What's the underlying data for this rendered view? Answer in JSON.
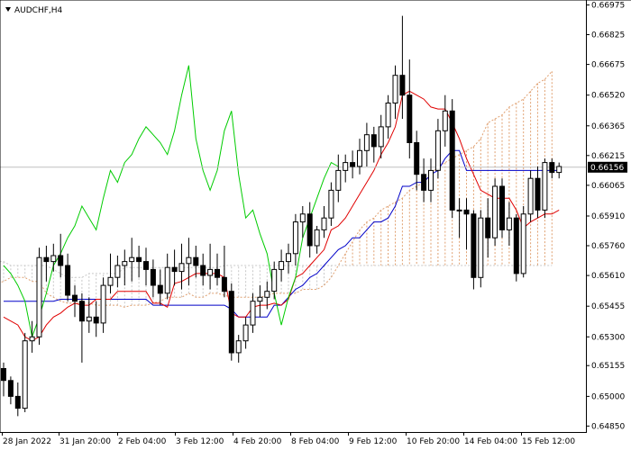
{
  "window": {
    "symbol_title": "AUDCHF,H4"
  },
  "colors": {
    "background": "#ffffff",
    "axis": "#000000",
    "bull_candle_body": "#ffffff",
    "bear_candle_body": "#000000",
    "tenkan_sen": "#e00000",
    "kijun_sen": "#0000c8",
    "chikou_span": "#00cc00",
    "senkou_span_a": "#e0a070",
    "senkou_span_b": "#c8c8c8",
    "current_price_line": "#c0c0c0",
    "price_tag_bg": "#000000",
    "price_tag_text": "#ffffff"
  },
  "chart_data": {
    "type": "candlestick",
    "title": "AUDCHF,H4",
    "x_tick_labels": [
      "28 Jan 2022",
      "31 Jan 20:00",
      "2 Feb 04:00",
      "3 Feb 12:00",
      "4 Feb 20:00",
      "8 Feb 04:00",
      "9 Feb 12:00",
      "10 Feb 20:00",
      "14 Feb 04:00",
      "15 Feb 12:00"
    ],
    "y_tick_labels": [
      "0.66975",
      "0.66825",
      "0.66675",
      "0.66520",
      "0.66365",
      "0.66215",
      "0.66065",
      "0.65910",
      "0.65760",
      "0.65610",
      "0.65455",
      "0.65300",
      "0.65155",
      "0.65000",
      "0.64850"
    ],
    "ylim": [
      0.6482,
      0.67
    ],
    "current_price": 0.66156,
    "current_price_label": "0.66156",
    "grid": false,
    "candles": [
      [
        0.6514,
        0.6517,
        0.65,
        0.6508
      ],
      [
        0.6508,
        0.651,
        0.6496,
        0.65
      ],
      [
        0.65,
        0.6507,
        0.649,
        0.6494
      ],
      [
        0.6494,
        0.6532,
        0.6492,
        0.6528
      ],
      [
        0.6528,
        0.6538,
        0.6522,
        0.653
      ],
      [
        0.653,
        0.6575,
        0.6526,
        0.657
      ],
      [
        0.657,
        0.6576,
        0.6558,
        0.6568
      ],
      [
        0.6568,
        0.6577,
        0.6563,
        0.6571
      ],
      [
        0.6571,
        0.6582,
        0.656,
        0.6566
      ],
      [
        0.6566,
        0.6572,
        0.6548,
        0.6551
      ],
      [
        0.6551,
        0.6556,
        0.654,
        0.6548
      ],
      [
        0.6548,
        0.6552,
        0.6517,
        0.6538
      ],
      [
        0.6538,
        0.655,
        0.6532,
        0.654
      ],
      [
        0.654,
        0.6548,
        0.653,
        0.6537
      ],
      [
        0.6537,
        0.656,
        0.6532,
        0.6556
      ],
      [
        0.6556,
        0.6572,
        0.6552,
        0.656
      ],
      [
        0.656,
        0.6571,
        0.6555,
        0.6566
      ],
      [
        0.6566,
        0.6574,
        0.6556,
        0.6568
      ],
      [
        0.6568,
        0.658,
        0.6558,
        0.657
      ],
      [
        0.657,
        0.6576,
        0.656,
        0.6568
      ],
      [
        0.6568,
        0.6575,
        0.6556,
        0.6564
      ],
      [
        0.6564,
        0.6569,
        0.655,
        0.6556
      ],
      [
        0.6556,
        0.6564,
        0.6546,
        0.6552
      ],
      [
        0.6552,
        0.6572,
        0.6549,
        0.6565
      ],
      [
        0.6565,
        0.6574,
        0.6556,
        0.6563
      ],
      [
        0.6563,
        0.6577,
        0.6554,
        0.6567
      ],
      [
        0.6567,
        0.658,
        0.6556,
        0.657
      ],
      [
        0.657,
        0.6576,
        0.656,
        0.6566
      ],
      [
        0.6566,
        0.6572,
        0.6556,
        0.6561
      ],
      [
        0.6561,
        0.6577,
        0.6554,
        0.6564
      ],
      [
        0.6564,
        0.6572,
        0.6556,
        0.656
      ],
      [
        0.656,
        0.6576,
        0.655,
        0.6553
      ],
      [
        0.6553,
        0.6557,
        0.6518,
        0.6522
      ],
      [
        0.6522,
        0.6531,
        0.6517,
        0.6528
      ],
      [
        0.6528,
        0.654,
        0.6524,
        0.6536
      ],
      [
        0.6536,
        0.6552,
        0.6532,
        0.6548
      ],
      [
        0.6548,
        0.6556,
        0.654,
        0.655
      ],
      [
        0.655,
        0.6558,
        0.6544,
        0.6553
      ],
      [
        0.6553,
        0.6568,
        0.6549,
        0.6564
      ],
      [
        0.6564,
        0.6574,
        0.6558,
        0.6568
      ],
      [
        0.6568,
        0.6577,
        0.6562,
        0.6572
      ],
      [
        0.6572,
        0.6592,
        0.6566,
        0.6588
      ],
      [
        0.6588,
        0.6596,
        0.658,
        0.6592
      ],
      [
        0.6592,
        0.6598,
        0.657,
        0.6576
      ],
      [
        0.6576,
        0.6586,
        0.6572,
        0.6584
      ],
      [
        0.6584,
        0.6596,
        0.658,
        0.659
      ],
      [
        0.659,
        0.6608,
        0.6586,
        0.6604
      ],
      [
        0.6604,
        0.6622,
        0.6598,
        0.6614
      ],
      [
        0.6614,
        0.6622,
        0.6608,
        0.6618
      ],
      [
        0.6618,
        0.6624,
        0.661,
        0.6616
      ],
      [
        0.6616,
        0.663,
        0.6612,
        0.6624
      ],
      [
        0.6624,
        0.6638,
        0.6616,
        0.6632
      ],
      [
        0.6632,
        0.6636,
        0.6618,
        0.6626
      ],
      [
        0.6626,
        0.6642,
        0.662,
        0.6636
      ],
      [
        0.6636,
        0.6652,
        0.663,
        0.6648
      ],
      [
        0.6648,
        0.6667,
        0.664,
        0.6662
      ],
      [
        0.6662,
        0.6692,
        0.664,
        0.6652
      ],
      [
        0.6652,
        0.667,
        0.662,
        0.6628
      ],
      [
        0.6628,
        0.6634,
        0.6604,
        0.6612
      ],
      [
        0.6612,
        0.662,
        0.6598,
        0.6604
      ],
      [
        0.6604,
        0.662,
        0.6598,
        0.6614
      ],
      [
        0.6614,
        0.664,
        0.661,
        0.6634
      ],
      [
        0.6634,
        0.6652,
        0.6626,
        0.6644
      ],
      [
        0.6644,
        0.665,
        0.659,
        0.6594
      ],
      [
        0.6594,
        0.66,
        0.658,
        0.6594
      ],
      [
        0.6594,
        0.66,
        0.6574,
        0.6592
      ],
      [
        0.6592,
        0.6594,
        0.6554,
        0.656
      ],
      [
        0.656,
        0.6594,
        0.6555,
        0.659
      ],
      [
        0.659,
        0.66,
        0.657,
        0.658
      ],
      [
        0.658,
        0.661,
        0.6576,
        0.6606
      ],
      [
        0.6606,
        0.661,
        0.658,
        0.6584
      ],
      [
        0.6584,
        0.6598,
        0.6576,
        0.659
      ],
      [
        0.659,
        0.6592,
        0.6558,
        0.6562
      ],
      [
        0.6562,
        0.6596,
        0.656,
        0.6592
      ],
      [
        0.6592,
        0.6614,
        0.6588,
        0.661
      ],
      [
        0.661,
        0.6616,
        0.659,
        0.6594
      ],
      [
        0.6594,
        0.662,
        0.659,
        0.6618
      ],
      [
        0.6618,
        0.662,
        0.661,
        0.6613
      ],
      [
        0.6613,
        0.6618,
        0.661,
        0.6616
      ]
    ],
    "tenkan_sen": [
      0.654,
      0.6538,
      0.6536,
      0.653,
      0.6528,
      0.653,
      0.6536,
      0.654,
      0.6542,
      0.6545,
      0.6547,
      0.6546,
      0.6546,
      0.6549,
      0.6549,
      0.6549,
      0.6553,
      0.6553,
      0.6553,
      0.6553,
      0.6553,
      0.6547,
      0.6547,
      0.6545,
      0.6557,
      0.6558,
      0.656,
      0.6562,
      0.6562,
      0.6562,
      0.6562,
      0.656,
      0.6542,
      0.654,
      0.654,
      0.6545,
      0.6546,
      0.6546,
      0.6547,
      0.6546,
      0.6549,
      0.656,
      0.6562,
      0.6566,
      0.657,
      0.6574,
      0.6584,
      0.6586,
      0.659,
      0.6596,
      0.6602,
      0.6608,
      0.6614,
      0.6622,
      0.6628,
      0.6636,
      0.6652,
      0.6654,
      0.6652,
      0.665,
      0.6646,
      0.6645,
      0.6645,
      0.6638,
      0.663,
      0.662,
      0.6612,
      0.6604,
      0.6602,
      0.66,
      0.66,
      0.66,
      0.6594,
      0.6585,
      0.6588,
      0.659,
      0.6592,
      0.6592,
      0.6594
    ],
    "kijun_sen": [
      0.6548,
      0.6548,
      0.6548,
      0.6548,
      0.6548,
      0.6548,
      0.6548,
      0.6548,
      0.6549,
      0.6549,
      0.6549,
      0.6549,
      0.6549,
      0.6549,
      0.6549,
      0.6549,
      0.6549,
      0.6549,
      0.6549,
      0.6549,
      0.6549,
      0.6546,
      0.6546,
      0.6546,
      0.6546,
      0.6546,
      0.6546,
      0.6546,
      0.6546,
      0.6546,
      0.6546,
      0.6546,
      0.6544,
      0.654,
      0.654,
      0.654,
      0.654,
      0.654,
      0.6546,
      0.6546,
      0.655,
      0.6554,
      0.6556,
      0.656,
      0.6562,
      0.6566,
      0.657,
      0.6574,
      0.6576,
      0.658,
      0.658,
      0.6584,
      0.6588,
      0.6588,
      0.659,
      0.6596,
      0.6606,
      0.6606,
      0.6608,
      0.6608,
      0.6612,
      0.6614,
      0.662,
      0.6624,
      0.6624,
      0.6614,
      0.6614,
      0.6614,
      0.6614,
      0.6614,
      0.6614,
      0.6614,
      0.6614,
      0.6614,
      0.6614,
      0.6614,
      0.6614,
      0.6614,
      0.6614
    ],
    "chikou_span": [
      0.6566,
      0.6562,
      0.6556,
      0.6548,
      0.653,
      0.654,
      0.6552,
      0.6566,
      0.6572,
      0.658,
      0.6586,
      0.6596,
      0.659,
      0.6584,
      0.66,
      0.6614,
      0.6608,
      0.6618,
      0.6622,
      0.663,
      0.6636,
      0.6632,
      0.6628,
      0.6622,
      0.6634,
      0.6652,
      0.6667,
      0.663,
      0.6614,
      0.6604,
      0.6614,
      0.6634,
      0.6644,
      0.6612,
      0.659,
      0.6594,
      0.6582,
      0.6572,
      0.6552,
      0.6536,
      0.655,
      0.656,
      0.658,
      0.659,
      0.66,
      0.661,
      0.6618,
      0.6616
    ],
    "senkou_span_a": [
      0.659,
      0.658,
      0.657,
      0.6568,
      0.6565,
      0.6563,
      0.656,
      0.6558,
      0.6552,
      0.6548,
      0.6546,
      0.6546,
      0.6547,
      0.6547,
      0.6547,
      0.6548,
      0.6549,
      0.6549,
      0.6549,
      0.6549,
      0.6549,
      0.655,
      0.6552,
      0.6553,
      0.6555,
      0.6557,
      0.6558,
      0.656,
      0.656,
      0.656,
      0.6558,
      0.6558,
      0.6552,
      0.655,
      0.6548,
      0.6547,
      0.6547,
      0.6547,
      0.6547,
      0.6546,
      0.6546,
      0.6546,
      0.6546,
      0.6545,
      0.6546,
      0.6546,
      0.6546,
      0.6547,
      0.6548,
      0.655,
      0.655,
      0.655,
      0.6552,
      0.655,
      0.655,
      0.6552,
      0.6552,
      0.6551,
      0.655,
      0.655,
      0.655,
      0.655,
      0.655,
      0.6551,
      0.6552,
      0.6552,
      0.6552,
      0.6552,
      0.6554,
      0.6554,
      0.6554,
      0.6556,
      0.656,
      0.6566,
      0.6572,
      0.6578,
      0.6584,
      0.6588,
      0.659,
      0.6594,
      0.6596,
      0.6598,
      0.66,
      0.6604,
      0.6606,
      0.6608,
      0.6612,
      0.6616,
      0.6618,
      0.662,
      0.6622,
      0.6624,
      0.6626,
      0.663,
      0.6638,
      0.664,
      0.6642,
      0.6646,
      0.6648,
      0.665,
      0.6654,
      0.6658,
      0.666,
      0.6664
    ],
    "senkou_span_b": [
      0.66,
      0.659,
      0.658,
      0.6575,
      0.6572,
      0.6572,
      0.6572,
      0.6572,
      0.6572,
      0.6572,
      0.6572,
      0.6572,
      0.6572,
      0.6572,
      0.6572,
      0.6568,
      0.6568,
      0.6568,
      0.6568,
      0.6568,
      0.6568,
      0.6568,
      0.6568,
      0.6568,
      0.6568,
      0.6568,
      0.6568,
      0.6566,
      0.6566,
      0.6566,
      0.6566,
      0.6566,
      0.6566,
      0.6564,
      0.6562,
      0.656,
      0.656,
      0.656,
      0.6562,
      0.6562,
      0.6562,
      0.6562,
      0.6562,
      0.6565,
      0.6565,
      0.6565,
      0.6565,
      0.6565,
      0.6565,
      0.6565,
      0.6565,
      0.6565,
      0.6565,
      0.6565,
      0.6565,
      0.6565,
      0.6565,
      0.6566,
      0.6566,
      0.6566,
      0.6566,
      0.6566,
      0.6566,
      0.6566,
      0.6566,
      0.6566,
      0.6566,
      0.6566,
      0.6566,
      0.6566,
      0.6566,
      0.6566,
      0.6566,
      0.6566,
      0.6566,
      0.6566,
      0.6566,
      0.6566,
      0.6566,
      0.6566,
      0.6566,
      0.6566,
      0.6566,
      0.6566,
      0.6566,
      0.6566,
      0.6566,
      0.6566,
      0.6566,
      0.6566,
      0.6566,
      0.6566,
      0.6566,
      0.6566,
      0.6566,
      0.6566,
      0.6566,
      0.6566,
      0.6566,
      0.6566,
      0.6566,
      0.6566,
      0.6566,
      0.6566
    ]
  }
}
